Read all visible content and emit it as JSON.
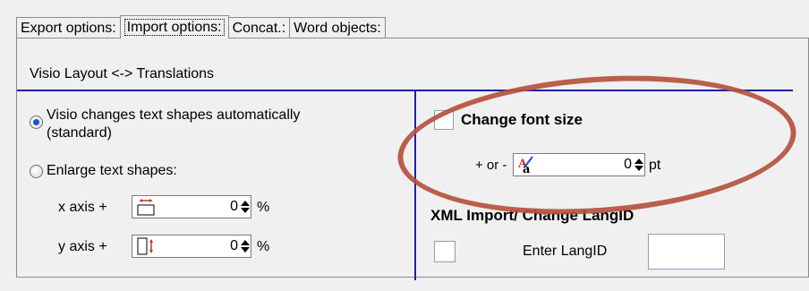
{
  "tabs": [
    {
      "label": "Export options:",
      "active": false
    },
    {
      "label": "Import options:",
      "active": true
    },
    {
      "label": "Concat.:",
      "active": false
    },
    {
      "label": "Word objects:",
      "active": false
    }
  ],
  "section_title": "Visio Layout <-> Translations",
  "left": {
    "radio1_label_line1": "Visio changes text shapes automatically",
    "radio1_label_line2": "(standard)",
    "radio2_label": "Enlarge text shapes:",
    "x_axis_label": "x axis +",
    "x_axis_value": "0",
    "x_axis_unit": "%",
    "y_axis_label": "y axis +",
    "y_axis_value": "0",
    "y_axis_unit": "%",
    "radio1_selected": true,
    "radio2_selected": false
  },
  "right": {
    "change_font_size_label": "Change font size",
    "plus_minus_label": "+ or -",
    "font_size_value": "0",
    "font_size_unit": "pt",
    "xml_heading": "XML Import/ Change LangID",
    "enter_langid_label": "Enter LangID",
    "enter_langid_value": ""
  },
  "colors": {
    "accent_line": "#1d1fa8",
    "highlight_ellipse": "#b4533e",
    "radio_selected": "#1f4fcf"
  },
  "icons": {
    "x_axis_icon": "horizontal-resize-icon",
    "y_axis_icon": "vertical-resize-icon",
    "font_icon": "font-size-icon"
  }
}
